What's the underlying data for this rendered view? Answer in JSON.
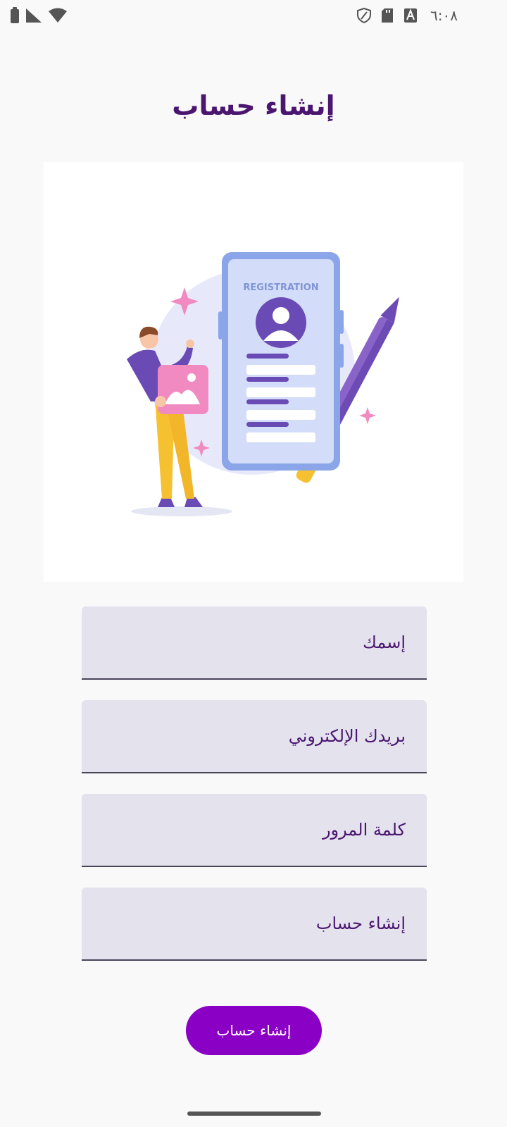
{
  "status_bar": {
    "time": "٦:٠٨",
    "icons_left": [
      "battery-icon",
      "signal-icon",
      "wifi-icon"
    ],
    "icons_right": [
      "shield-icon",
      "sd-card-icon",
      "font-a-icon"
    ]
  },
  "title": "إنشاء حساب",
  "illustration": {
    "card_text": "REGISTRATION",
    "icon": "registration-illustration"
  },
  "form": {
    "name_placeholder": "إسمك",
    "email_placeholder": "بريدك الإلكتروني",
    "password_placeholder": "كلمة المرور",
    "fourth_placeholder": "إنشاء حساب",
    "submit_label": "إنشاء حساب"
  },
  "colors": {
    "title": "#4a1670",
    "button": "#8a00c4",
    "field_bg": "#e3e2ed"
  }
}
